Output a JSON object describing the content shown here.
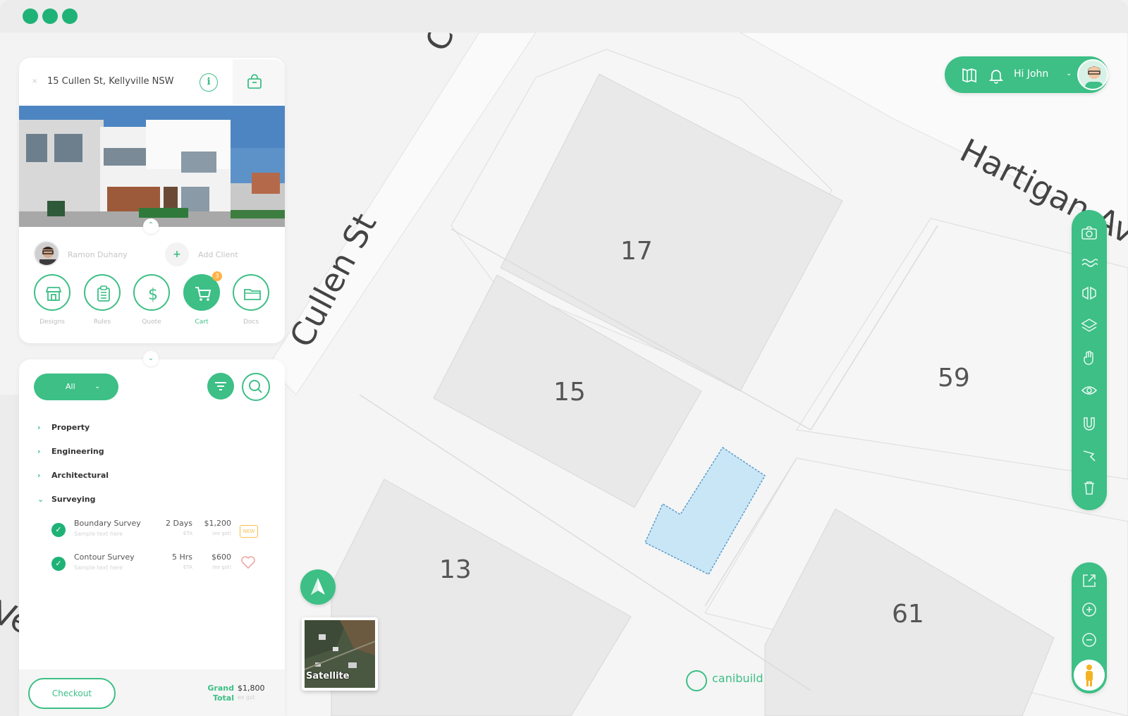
{
  "address": "15 Cullen St, Kellyville NSW",
  "agent": {
    "name": "Ramon Duhany",
    "add_client_label": "Add Client",
    "add_symbol": "+"
  },
  "actions": [
    {
      "label": "Designs",
      "icon": "shop-icon"
    },
    {
      "label": "Rules",
      "icon": "clipboard-icon"
    },
    {
      "label": "Quote",
      "icon": "dollar-icon"
    },
    {
      "label": "Cart",
      "icon": "cart-icon",
      "active": true,
      "badge": "3"
    },
    {
      "label": "Docs",
      "icon": "folder-icon"
    }
  ],
  "filter": {
    "selected": "All",
    "chevron": "⌄"
  },
  "categories": [
    {
      "label": "Property",
      "caret": "›"
    },
    {
      "label": "Engineering",
      "caret": "›"
    },
    {
      "label": "Architectural",
      "caret": "›"
    },
    {
      "label": "Surveying",
      "caret": "⌄"
    }
  ],
  "services": [
    {
      "name": "Boundary Survey",
      "sub": "Sample text here",
      "time": "2 Days",
      "eta": "ETA",
      "price": "$1,200",
      "gst": "(ex gst)",
      "tag": "NEW"
    },
    {
      "name": "Contour Survey",
      "sub": "Sample text here",
      "time": "5 Hrs",
      "eta": "ETA",
      "price": "$600",
      "gst": "(ex gst)"
    }
  ],
  "footer": {
    "checkout_label": "Checkout",
    "grand_label_1": "Grand",
    "grand_label_2": "Total",
    "grand_price": "$1,800",
    "grand_gst": "ex gst"
  },
  "user": {
    "greeting": "Hi John",
    "chevron": "⌄"
  },
  "map": {
    "streets": [
      "Cullen St",
      "Cullen St",
      "Hartigan Av",
      "Ve"
    ],
    "lots": [
      "17",
      "15",
      "59",
      "13",
      "61"
    ]
  },
  "satellite_label": "Satellite",
  "brand": "canibuild",
  "colors": {
    "accent": "#3dbf86",
    "accent_dark": "#1fb277",
    "selection": "#c9e6f7"
  }
}
